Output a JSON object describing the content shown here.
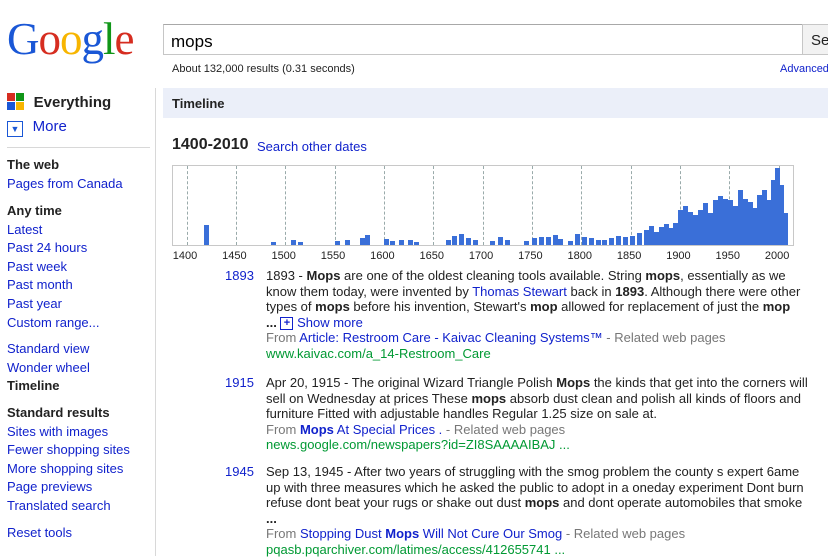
{
  "logo": {
    "text": [
      "G",
      "o",
      "o",
      "g",
      "l",
      "e"
    ],
    "colors": [
      "#1a57d6",
      "#d62d20",
      "#f7b500",
      "#1a57d6",
      "#109618",
      "#d62d20"
    ]
  },
  "search": {
    "query": "mops",
    "button_label": "Se"
  },
  "stats": "About 132,000 results (0.31 seconds)",
  "advanced_label": "Advanced",
  "sidebar": {
    "everything": "Everything",
    "more": "More",
    "the_web": "The web",
    "pages_from_canada": "Pages from Canada",
    "any_time": "Any time",
    "latest": "Latest",
    "past_24_hours": "Past 24 hours",
    "past_week": "Past week",
    "past_month": "Past month",
    "past_year": "Past year",
    "custom_range": "Custom range...",
    "standard_view": "Standard view",
    "wonder_wheel": "Wonder wheel",
    "timeline": "Timeline",
    "standard_results": "Standard results",
    "sites_with_images": "Sites with images",
    "fewer_shopping_sites": "Fewer shopping sites",
    "more_shopping_sites": "More shopping sites",
    "page_previews": "Page previews",
    "translated_search": "Translated search",
    "reset_tools": "Reset tools"
  },
  "timeline": {
    "header": "Timeline",
    "range": "1400-2010",
    "search_other_dates": "Search other dates"
  },
  "chart_data": {
    "type": "bar",
    "x_range": [
      1400,
      2010
    ],
    "x_ticks": [
      "1400",
      "1450",
      "1500",
      "1550",
      "1600",
      "1650",
      "1700",
      "1750",
      "1800",
      "1850",
      "1900",
      "1950",
      "2000"
    ],
    "bars": [
      {
        "year": 1420,
        "value": 26
      },
      {
        "year": 1488,
        "value": 4
      },
      {
        "year": 1508,
        "value": 6
      },
      {
        "year": 1516,
        "value": 4
      },
      {
        "year": 1553,
        "value": 5
      },
      {
        "year": 1563,
        "value": 7
      },
      {
        "year": 1578,
        "value": 9
      },
      {
        "year": 1583,
        "value": 13
      },
      {
        "year": 1603,
        "value": 8
      },
      {
        "year": 1609,
        "value": 5
      },
      {
        "year": 1618,
        "value": 7
      },
      {
        "year": 1627,
        "value": 6
      },
      {
        "year": 1633,
        "value": 4
      },
      {
        "year": 1665,
        "value": 6
      },
      {
        "year": 1672,
        "value": 12
      },
      {
        "year": 1679,
        "value": 14
      },
      {
        "year": 1686,
        "value": 9
      },
      {
        "year": 1693,
        "value": 7
      },
      {
        "year": 1710,
        "value": 5
      },
      {
        "year": 1718,
        "value": 10
      },
      {
        "year": 1725,
        "value": 7
      },
      {
        "year": 1745,
        "value": 5
      },
      {
        "year": 1753,
        "value": 9
      },
      {
        "year": 1760,
        "value": 10
      },
      {
        "year": 1767,
        "value": 11
      },
      {
        "year": 1774,
        "value": 13
      },
      {
        "year": 1779,
        "value": 8
      },
      {
        "year": 1789,
        "value": 5
      },
      {
        "year": 1796,
        "value": 14
      },
      {
        "year": 1803,
        "value": 11
      },
      {
        "year": 1810,
        "value": 9
      },
      {
        "year": 1817,
        "value": 7
      },
      {
        "year": 1824,
        "value": 6
      },
      {
        "year": 1831,
        "value": 9
      },
      {
        "year": 1838,
        "value": 12
      },
      {
        "year": 1845,
        "value": 10
      },
      {
        "year": 1852,
        "value": 12
      },
      {
        "year": 1859,
        "value": 15
      },
      {
        "year": 1866,
        "value": 20
      },
      {
        "year": 1871,
        "value": 25
      },
      {
        "year": 1876,
        "value": 17
      },
      {
        "year": 1881,
        "value": 23
      },
      {
        "year": 1886,
        "value": 27
      },
      {
        "year": 1891,
        "value": 22
      },
      {
        "year": 1896,
        "value": 28
      },
      {
        "year": 1901,
        "value": 45
      },
      {
        "year": 1906,
        "value": 50
      },
      {
        "year": 1911,
        "value": 43
      },
      {
        "year": 1916,
        "value": 39
      },
      {
        "year": 1921,
        "value": 46
      },
      {
        "year": 1926,
        "value": 55
      },
      {
        "year": 1931,
        "value": 42
      },
      {
        "year": 1936,
        "value": 58
      },
      {
        "year": 1941,
        "value": 63
      },
      {
        "year": 1946,
        "value": 60
      },
      {
        "year": 1951,
        "value": 58
      },
      {
        "year": 1956,
        "value": 50
      },
      {
        "year": 1961,
        "value": 72
      },
      {
        "year": 1966,
        "value": 60
      },
      {
        "year": 1971,
        "value": 56
      },
      {
        "year": 1976,
        "value": 48
      },
      {
        "year": 1981,
        "value": 65
      },
      {
        "year": 1986,
        "value": 72
      },
      {
        "year": 1991,
        "value": 58
      },
      {
        "year": 1995,
        "value": 85
      },
      {
        "year": 1999,
        "value": 100
      },
      {
        "year": 2003,
        "value": 78
      },
      {
        "year": 2007,
        "value": 42
      }
    ]
  },
  "results": [
    {
      "year": "1893",
      "lines": [
        [
          {
            "t": "1893 - "
          },
          {
            "t": "Mops",
            "b": true
          },
          {
            "t": " are one of the oldest cleaning tools available. String "
          },
          {
            "t": "mops",
            "b": true
          },
          {
            "t": ", essentially as we"
          }
        ],
        [
          {
            "t": "know them today, were invented by "
          },
          {
            "t": "Thomas Stewart",
            "link": true
          },
          {
            "t": " back in "
          },
          {
            "t": "1893",
            "b": true
          },
          {
            "t": ". Although there were other"
          }
        ],
        [
          {
            "t": "types of "
          },
          {
            "t": "mops",
            "b": true
          },
          {
            "t": " before his invention, Stewart's "
          },
          {
            "t": "mop",
            "b": true
          },
          {
            "t": " allowed for replacement of just the "
          },
          {
            "t": "mop",
            "b": true
          }
        ]
      ],
      "ellipsis": "...",
      "show_more": "Show more",
      "from_label": "From",
      "source_link": "Article: Restroom Care - Kaivac Cleaning Systems™",
      "related": "- Related web pages",
      "url": "www.kaivac.com/a_14-Restroom_Care"
    },
    {
      "year": "1915",
      "lines": [
        [
          {
            "t": "Apr 20, 1915 - The original Wizard Triangle Polish "
          },
          {
            "t": "Mops",
            "b": true
          },
          {
            "t": " the kinds that get into the corners will"
          }
        ],
        [
          {
            "t": "sell on Wednesday at prices These "
          },
          {
            "t": "mops",
            "b": true
          },
          {
            "t": " absorb dust clean and polish all kinds of floors and"
          }
        ],
        [
          {
            "t": "furniture Fitted with adjustable handles Regular 1.25 size on sale at."
          }
        ]
      ],
      "from_label": "From",
      "source_link": [
        {
          "t": "Mops",
          "b": true
        },
        {
          "t": " At Special Prices ."
        }
      ],
      "related": "- Related web pages",
      "url": "news.google.com/newspapers?id=ZI8SAAAAIBAJ ..."
    },
    {
      "year": "1945",
      "lines": [
        [
          {
            "t": "Sep 13, 1945 - After two years of struggling with the smog problem the county s expert 6ame"
          }
        ],
        [
          {
            "t": "up with three measures which he asked the public to adopt in a oneday experiment Dont burn"
          }
        ],
        [
          {
            "t": "refuse dont beat your rugs or shake out dust "
          },
          {
            "t": "mops",
            "b": true
          },
          {
            "t": " and dont operate automobiles that smoke"
          }
        ]
      ],
      "ellipsis": "...",
      "from_label": "From",
      "source_link": [
        {
          "t": "Stopping Dust "
        },
        {
          "t": "Mops",
          "b": true
        },
        {
          "t": " Will Not Cure Our Smog"
        }
      ],
      "related": "- Related web pages",
      "url": "pqasb.pqarchiver.com/latimes/access/412655741 ..."
    }
  ]
}
